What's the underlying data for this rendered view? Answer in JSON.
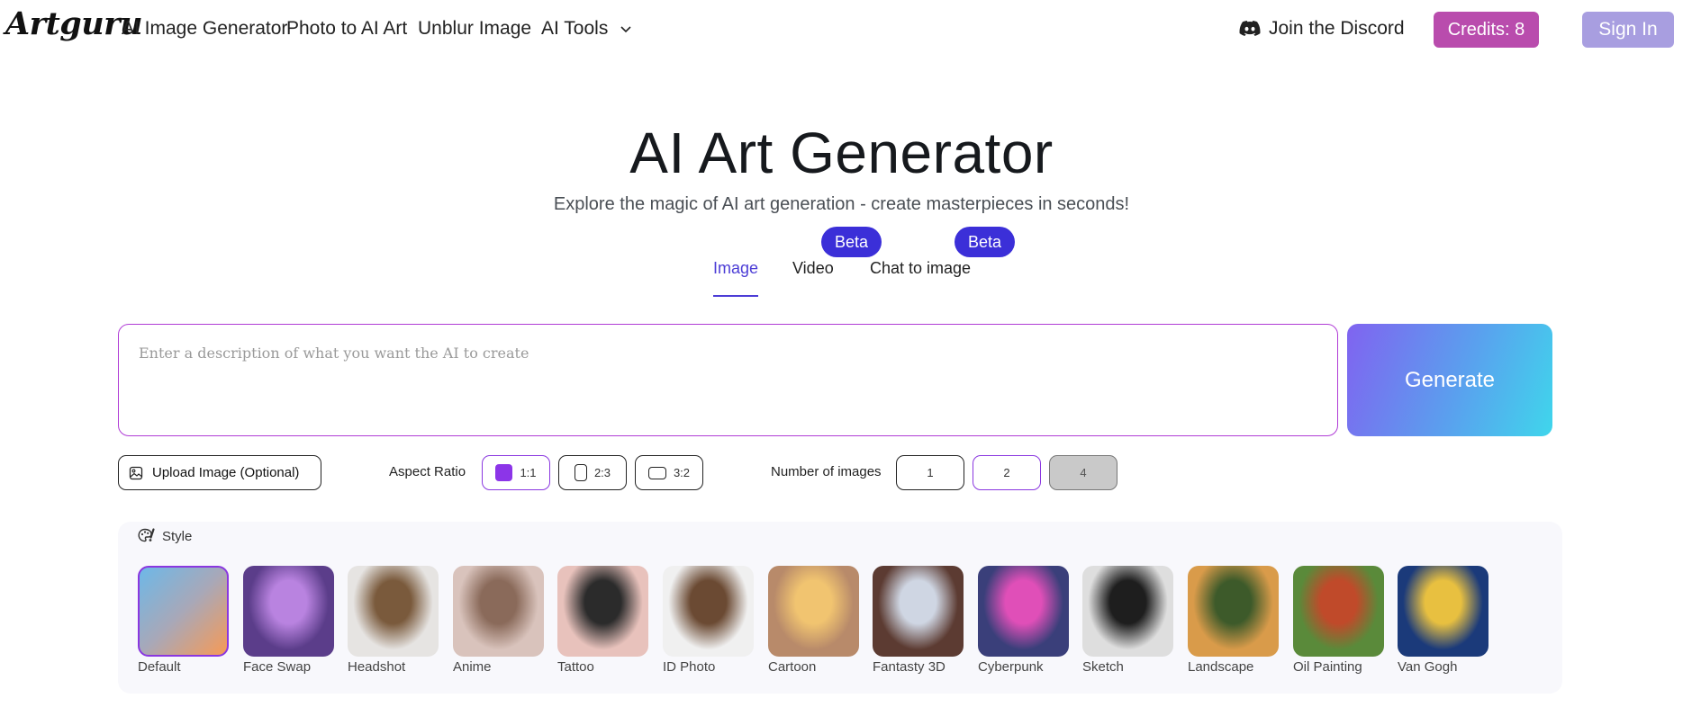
{
  "header": {
    "logo": "Artguru",
    "nav": [
      "AI Image Generator",
      "Photo to AI Art",
      "Unblur Image",
      "AI Tools"
    ],
    "discord": "Join the Discord",
    "credits": "Credits: 8",
    "sign_in": "Sign In"
  },
  "hero": {
    "title": "AI Art Generator",
    "subtitle": "Explore the magic of AI art generation - create masterpieces in seconds!"
  },
  "tabs": [
    {
      "label": "Image",
      "active": true
    },
    {
      "label": "Video",
      "badge": "Beta"
    },
    {
      "label": "Chat to image",
      "badge": "Beta"
    }
  ],
  "prompt": {
    "placeholder": "Enter a description of what you want the AI to create",
    "value": "",
    "generate_label": "Generate"
  },
  "options": {
    "upload_label": "Upload Image (Optional)",
    "aspect_label": "Aspect Ratio",
    "aspect_ratios": [
      "1:1",
      "2:3",
      "3:2"
    ],
    "aspect_selected": "1:1",
    "count_label": "Number of images",
    "counts": [
      "1",
      "2",
      "4"
    ],
    "count_selected": "2",
    "count_disabled": "4"
  },
  "style": {
    "heading": "Style",
    "selected": "Default",
    "items": [
      {
        "name": "Default",
        "icon": "gradient-swatch",
        "colors": [
          "#6db8e8",
          "#f79a55"
        ]
      },
      {
        "name": "Face Swap",
        "icon": "face-swap-thumb",
        "colors": [
          "#5b3d8a",
          "#b983e0"
        ]
      },
      {
        "name": "Headshot",
        "icon": "portrait-thumb",
        "colors": [
          "#e6e4e2",
          "#7a5a3c"
        ]
      },
      {
        "name": "Anime",
        "icon": "anime-thumb",
        "colors": [
          "#d9c3bc",
          "#8a6a5a"
        ]
      },
      {
        "name": "Tattoo",
        "icon": "wolf-thumb",
        "colors": [
          "#e8c2bc",
          "#2b2b2b"
        ]
      },
      {
        "name": "ID Photo",
        "icon": "id-photo-thumb",
        "colors": [
          "#f0f0f0",
          "#6b4a33"
        ]
      },
      {
        "name": "Cartoon",
        "icon": "cartoon-thumb",
        "colors": [
          "#b88a6a",
          "#f1c470"
        ]
      },
      {
        "name": "Fantasty 3D",
        "icon": "fantasy-thumb",
        "colors": [
          "#5c3b32",
          "#cfd6e3"
        ]
      },
      {
        "name": "Cyberpunk",
        "icon": "cyberpunk-thumb",
        "colors": [
          "#3a3f7a",
          "#e04fb8"
        ]
      },
      {
        "name": "Sketch",
        "icon": "sketch-thumb",
        "colors": [
          "#dedede",
          "#1e1e1e"
        ]
      },
      {
        "name": "Landscape",
        "icon": "landscape-thumb",
        "colors": [
          "#d99b4a",
          "#3d5a2a"
        ]
      },
      {
        "name": "Oil Painting",
        "icon": "oil-painting-thumb",
        "colors": [
          "#5a8a3a",
          "#c04a2a"
        ]
      },
      {
        "name": "Van Gogh",
        "icon": "starry-night-thumb",
        "colors": [
          "#1b3a7a",
          "#e8c040"
        ]
      }
    ]
  }
}
